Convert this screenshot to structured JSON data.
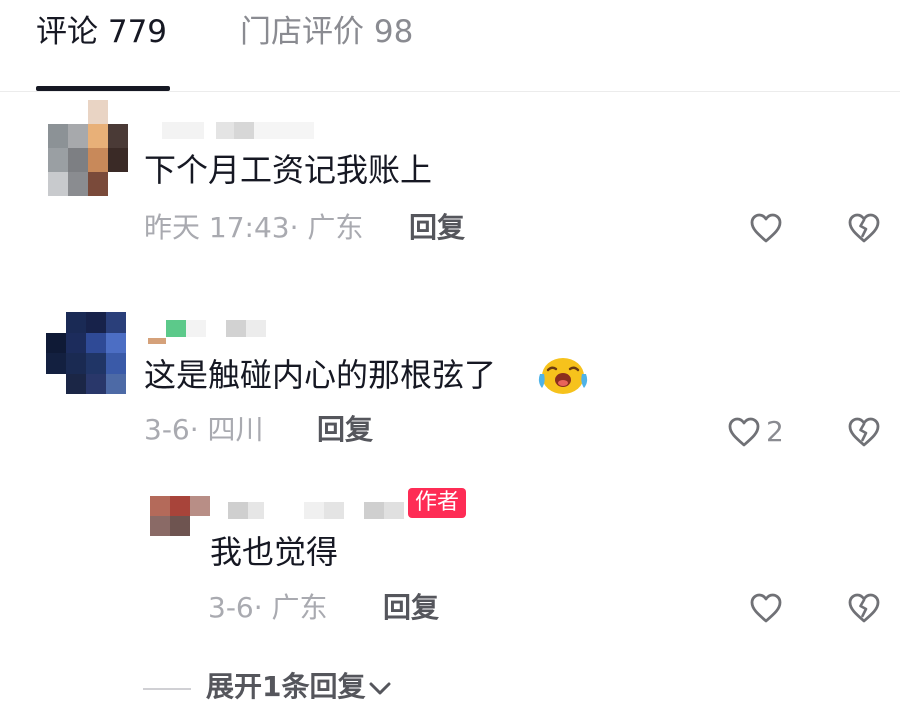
{
  "tabs": [
    {
      "label": "评论 779",
      "active": true
    },
    {
      "label": "门店评价 98",
      "active": false
    }
  ],
  "comments": [
    {
      "text": "下个月工资记我账上",
      "time": "昨天 17:43· 广东",
      "reply": "回复",
      "likes": ""
    },
    {
      "text": "这是触碰内心的那根弦了",
      "time": "3-6· 四川",
      "reply": "回复",
      "likes": "2"
    }
  ],
  "subreply": {
    "badge": "作者",
    "text": "我也觉得",
    "time": "3-6· 广东",
    "reply": "回复"
  },
  "expand_label": "展开1条回复",
  "icons": {
    "like": "heart-outline-icon",
    "dislike": "broken-heart-icon",
    "expand": "chevron-down-icon",
    "emoji": "crying-face-emoji"
  },
  "colors": {
    "text": "#161823",
    "muted": "#a9aab0",
    "badge": "#fe2c55"
  }
}
